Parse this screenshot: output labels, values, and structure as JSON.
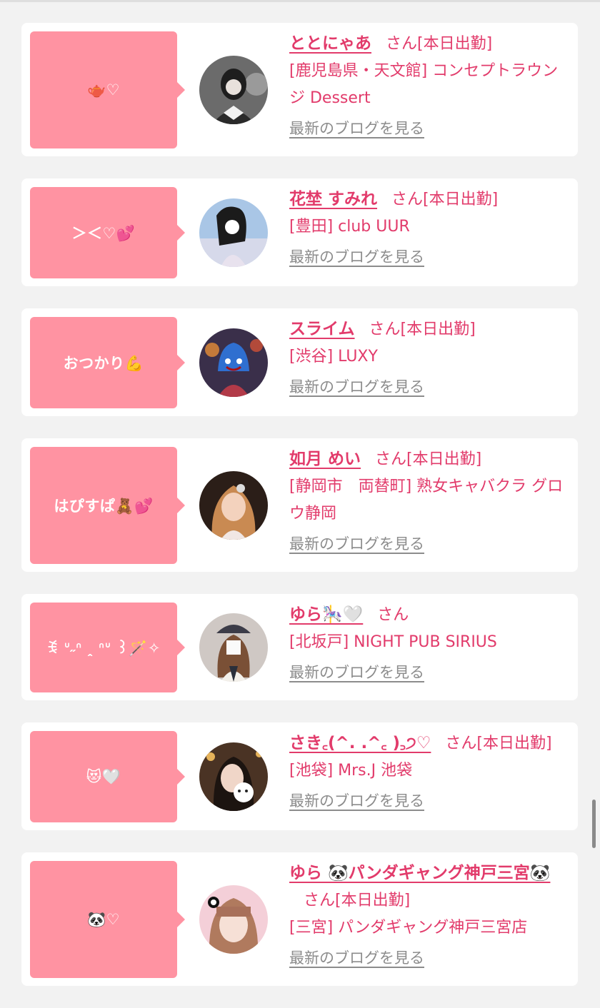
{
  "cards": [
    {
      "bubble": "🫖♡",
      "name": "ととにゃあ",
      "suffix": "さん[本日出勤]",
      "shop": "[鹿児島県・天文館] コンセプトラウンジ Dessert",
      "blog": "最新のブログを見る"
    },
    {
      "bubble": "＞＜♡💕",
      "name": "花埜 すみれ",
      "suffix": "さん[本日出勤]",
      "shop": "[豊田] club UUR",
      "blog": "最新のブログを見る"
    },
    {
      "bubble": "おつかり💪",
      "name": "スライム",
      "suffix": "さん[本日出勤]",
      "shop": "[渋谷] LUXY",
      "blog": "最新のブログを見る"
    },
    {
      "bubble": "はぴすぱ🧸💕",
      "name": "如月 めい",
      "suffix": "さん[本日出勤]",
      "shop": "[静岡市　両替町] 熟女キャバクラ グロウ静岡",
      "blog": "最新のブログを見る"
    },
    {
      "bubble": "ꉂ ᐡ˶ᐢ ꞈ ᐢᐡ ꒱🪄✧",
      "name": "ゆら🎠🤍",
      "suffix": "さん",
      "shop": "[北坂戸] NIGHT PUB SIRIUS",
      "blog": "最新のブログを見る"
    },
    {
      "bubble": "😻🤍",
      "name": "さき꜀(^. .^꜀ )꜆੭♡",
      "suffix": "さん[本日出勤]",
      "shop": "[池袋] Mrs.J 池袋",
      "blog": "最新のブログを見る"
    },
    {
      "bubble": "🐼♡",
      "name": "ゆら 🐼パンダギャング神戸三宮🐼",
      "suffix": "さん[本日出勤]",
      "shop": "[三宮] パンダギャング神戸三宮店",
      "blog": "最新のブログを見る"
    }
  ]
}
